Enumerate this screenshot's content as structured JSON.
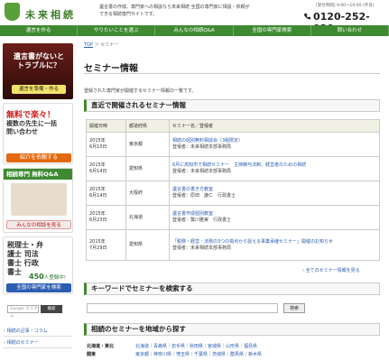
{
  "header": {
    "logo_text": "未来相続",
    "description": "遺言書の作成、専門家への相談なら未来相続 全国の専門家に相談・依頼ができる相続専門サイトです。",
    "hours": "[受付時間] 9:00～19:00 (平日)",
    "phone": "0120-252-930"
  },
  "nav": [
    "遺言を作る",
    "やりたいことを選ぶ",
    "みんなの相続Q&A",
    "全国の専門家検索",
    "問い合わせ"
  ],
  "sidebar": {
    "banner1": {
      "text": "遺言書がないとトラブルに？",
      "button": "遺言を準備・作る"
    },
    "banner2": {
      "title": "無料で楽々！",
      "text": "複数の先生に一括問い合わせ",
      "button": "紹介を依頼する"
    },
    "banner3": {
      "title": "相続専門 無料Q&A",
      "button": "みんなの相談を見る"
    },
    "banner4": {
      "title": "税理士・弁護士 司法書士 行政書士",
      "count_num": "450",
      "count_suffix": "人登録中!",
      "button": "全国の専門家を検索"
    },
    "search_placeholder": "Google カスタム",
    "search_button": "検索",
    "links": [
      "相続の記事・コラム",
      "相続のセミナー"
    ]
  },
  "main": {
    "breadcrumb_top": "TOP",
    "breadcrumb_sep": "＞",
    "breadcrumb_current": "セミナー",
    "title": "セミナー情報",
    "lead": "登録された専門家が開催するセミナー情報の一覧です。",
    "section_recent": "直近で開催されるセミナー情報",
    "table_headers": [
      "開催日時",
      "都道府県",
      "セミナー名／登壇者"
    ],
    "seminars": [
      {
        "date": "2015年\n6月10日",
        "pref": "東京都",
        "name": "相続の個別無料相談会（3組限定）",
        "speaker": "登壇者：未来相続本部事務局"
      },
      {
        "date": "2015年\n6月14日",
        "pref": "愛知県",
        "name": "6月に高知市で相続セミナー　主節精与法制、経営者のための相続",
        "speaker": "登壇者：未来相続本部事務局"
      },
      {
        "date": "2015年\n6月14日",
        "pref": "大阪府",
        "name": "遺言書の書き方教室",
        "speaker": "登壇者：原田　謙仁　行政書士"
      },
      {
        "date": "2015年\n6月23日",
        "pref": "北海道",
        "name": "遺言書作成個別教室",
        "speaker": "登壇者：鷲川雅実　行政書士"
      },
      {
        "date": "2015年\n7月29日",
        "pref": "愛知県",
        "name": "「税務・経営・法務の3つの視点から捉える事業承継セミナー」開催のお知らせ",
        "speaker": "登壇者：未来相続本部事務局"
      }
    ],
    "more_link": "› 全てのセミナー情報を見る",
    "section_keyword": "キーワードでセミナーを検索する",
    "keyword_button": "検索",
    "section_region": "相続のセミナーを地域から探す",
    "regions": [
      {
        "name": "北海道・東北",
        "prefs": "北海道｜青森県｜岩手県｜秋田県｜宮城県｜山形県｜福島県"
      },
      {
        "name": "関東",
        "prefs": "東京都｜神奈川県｜埼玉県｜千葉県｜茨城県｜群馬県｜栃木県"
      }
    ]
  }
}
